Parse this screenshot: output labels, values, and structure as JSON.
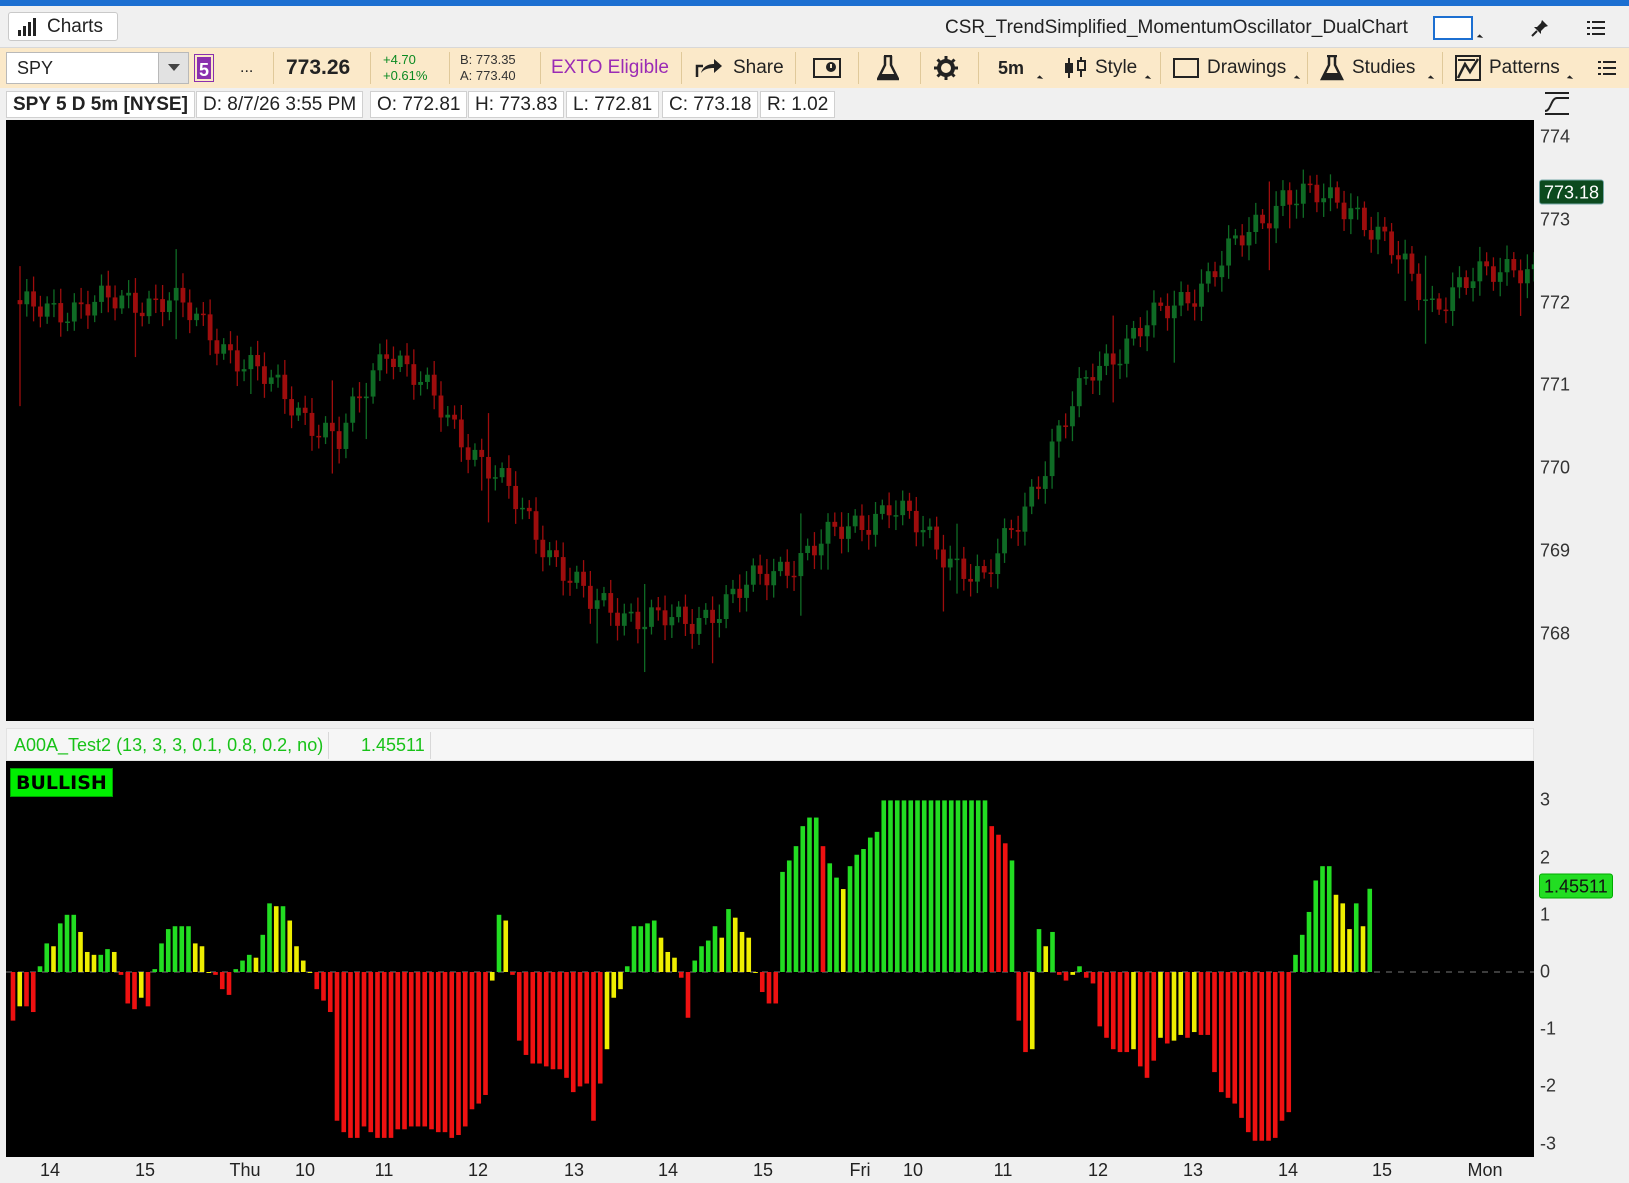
{
  "window": {
    "tab_label": "Charts",
    "layout_name": "CSR_TrendSimplified_MomentumOscillator_DualChart"
  },
  "toolbar": {
    "symbol": "SPY",
    "link_group": "5",
    "more": "...",
    "last_price": "773.26",
    "net_change": "+4.70",
    "pct_change": "+0.61%",
    "bid": "B: 773.35",
    "ask": "A: 773.40",
    "exto": "EXTO Eligible",
    "share": "Share",
    "timeframe": "5m",
    "style": "Style",
    "drawings": "Drawings",
    "studies": "Studies",
    "patterns": "Patterns",
    "colors": {
      "link": "#8a2fae",
      "exto": "#9b2bb5",
      "up": "#0b8a22"
    }
  },
  "chart_info": {
    "title": "SPY 5 D 5m [NYSE]",
    "date": "D: 8/7/26 3:55 PM",
    "open": "O: 772.81",
    "high": "H: 773.83",
    "low": "L: 772.81",
    "close": "C: 773.18",
    "range": "R: 1.02"
  },
  "price_axis": {
    "ticks": [
      "774",
      "773",
      "772",
      "771",
      "770",
      "769",
      "768"
    ],
    "current_badge": "773.18",
    "colors": {
      "badge_bg": "#0c4a1e",
      "badge_fg": "#ffffff"
    }
  },
  "oscillator": {
    "study_label": "A00A_Test2 (13, 3, 3, 0.1, 0.8, 0.2, no)",
    "study_value": "1.45511",
    "state_label": "BULLISH",
    "ticks": [
      "3",
      "2",
      "1",
      "0",
      "-1",
      "-2",
      "-3"
    ],
    "current_badge": "1.45511",
    "colors": {
      "bull": "#22dd22",
      "bear": "#ee1111",
      "neutral": "#eeee00"
    }
  },
  "time_axis": {
    "labels": [
      "14",
      "15",
      "Thu",
      "10",
      "11",
      "12",
      "13",
      "14",
      "15",
      "Fri",
      "10",
      "11",
      "12",
      "13",
      "14",
      "15",
      "Mon"
    ]
  },
  "chart_data": [
    {
      "type": "candlestick",
      "title": "SPY 5 D 5m [NYSE]",
      "ylim": [
        767.2,
        774.2
      ],
      "anchors_x_bar": [
        0,
        22,
        47,
        54,
        70,
        84,
        98,
        114,
        128,
        142,
        158,
        175,
        186,
        196,
        208,
        220,
        230
      ],
      "anchors_close": [
        771.9,
        772.05,
        770.3,
        771.5,
        769.9,
        768.35,
        768.1,
        768.9,
        769.55,
        768.6,
        771.2,
        772.3,
        773.3,
        773.2,
        772.0,
        772.5,
        772.0
      ],
      "tail": [
        [
          236,
          771.8
        ],
        [
          240,
          771.5
        ],
        [
          246,
          771.0
        ],
        [
          250,
          771.4
        ],
        [
          254,
          772.3
        ],
        [
          258,
          772.7
        ],
        [
          262,
          772.85
        ],
        [
          266,
          772.9
        ],
        [
          268,
          772.75
        ],
        [
          271,
          772.85
        ],
        [
          274,
          772.95
        ],
        [
          277,
          773.18
        ]
      ],
      "bars": 278,
      "last_close": 773.18
    },
    {
      "type": "bar",
      "title": "A00A_Test2 (13, 3, 3, 0.1, 0.8, 0.2, no)",
      "ylim": [
        -3.3,
        3.3
      ],
      "values": [
        -0.85,
        -0.6,
        -0.6,
        -0.7,
        0.1,
        0.5,
        0.45,
        0.85,
        1.0,
        1.0,
        0.7,
        0.35,
        0.3,
        0.3,
        0.4,
        0.35,
        -0.05,
        -0.55,
        -0.65,
        -0.45,
        -0.6,
        0.05,
        0.5,
        0.75,
        0.8,
        0.8,
        0.8,
        0.5,
        0.45,
        0.0,
        -0.05,
        -0.3,
        -0.4,
        0.05,
        0.2,
        0.3,
        0.25,
        0.65,
        1.2,
        1.15,
        1.15,
        0.9,
        0.45,
        0.2,
        0.0,
        -0.3,
        -0.5,
        -0.7,
        -2.6,
        -2.8,
        -2.9,
        -2.9,
        -2.7,
        -2.8,
        -2.9,
        -2.9,
        -2.9,
        -2.75,
        -2.75,
        -2.7,
        -2.7,
        -2.7,
        -2.75,
        -2.8,
        -2.8,
        -2.9,
        -2.85,
        -2.7,
        -2.4,
        -2.3,
        -2.15,
        -0.15,
        1.0,
        0.9,
        -0.05,
        -1.2,
        -1.45,
        -1.6,
        -1.6,
        -1.65,
        -1.7,
        -1.7,
        -1.85,
        -2.1,
        -2.0,
        -1.95,
        -2.6,
        -1.95,
        -1.35,
        -0.45,
        -0.3,
        0.1,
        0.8,
        0.8,
        0.85,
        0.9,
        0.6,
        0.35,
        0.25,
        -0.1,
        -0.8,
        0.2,
        0.45,
        0.55,
        0.8,
        0.6,
        1.1,
        0.95,
        0.7,
        0.6,
        0.0,
        -0.35,
        -0.55,
        -0.55,
        1.75,
        1.95,
        2.2,
        2.55,
        2.7,
        2.7,
        2.2,
        1.9,
        1.65,
        1.45,
        1.85,
        2.05,
        2.15,
        2.35,
        2.45,
        3.0,
        3.0,
        3.0,
        3.0,
        3.0,
        3.0,
        3.0,
        3.0,
        3.0,
        3.0,
        3.0,
        3.0,
        3.0,
        3.0,
        3.0,
        3.0,
        2.55,
        2.4,
        2.25,
        1.95,
        -0.85,
        -1.4,
        -1.35,
        0.75,
        0.45,
        0.7,
        -0.05,
        -0.15,
        -0.05,
        0.1,
        -0.1,
        -0.2,
        -0.95,
        -1.15,
        -1.35,
        -1.4,
        -1.4,
        -1.35,
        -1.65,
        -1.85,
        -1.55,
        -1.15,
        -1.25,
        -1.2,
        -1.1,
        -1.15,
        -1.05,
        -1.1,
        -1.1,
        -1.75,
        -2.1,
        -2.2,
        -2.3,
        -2.55,
        -2.8,
        -2.95,
        -2.95,
        -2.95,
        -2.9,
        -2.6,
        -2.45,
        0.3,
        0.65,
        1.05,
        1.6,
        1.85,
        1.85,
        1.35,
        1.2,
        0.75,
        1.2,
        0.8,
        1.45511
      ],
      "last_value": 1.45511
    }
  ]
}
